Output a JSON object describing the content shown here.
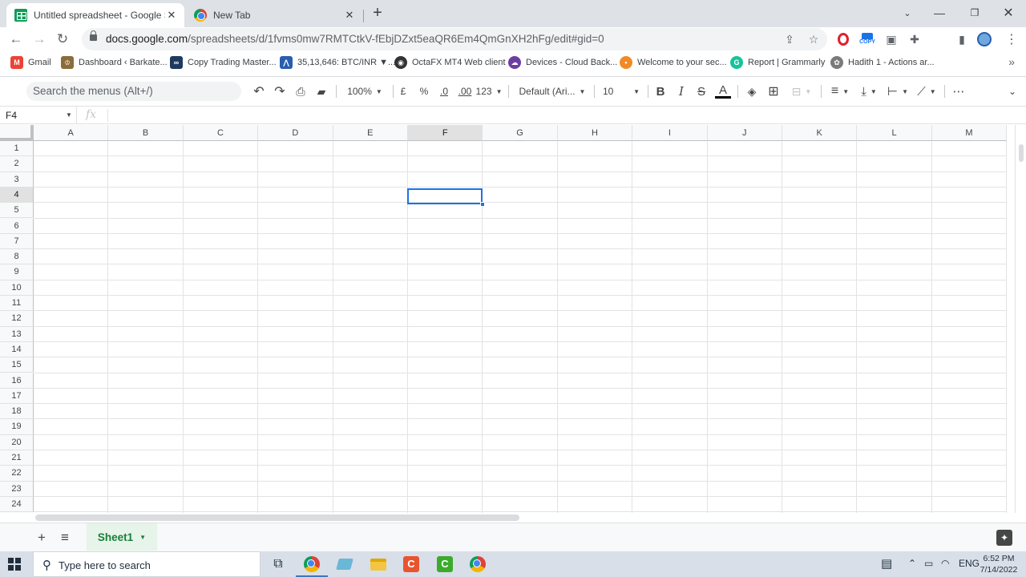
{
  "browser": {
    "tabs": [
      {
        "title": "Untitled spreadsheet - Google Shee",
        "active": true
      },
      {
        "title": "New Tab",
        "active": false
      }
    ],
    "url_host": "docs.google.com",
    "url_path": "/spreadsheets/d/1fvms0mw7RMTCtkV-fEbjDZxt5eaQR6Em4QmGnXH2hFg/edit#gid=0",
    "extension_copy_label": "COPY"
  },
  "bookmarks": [
    {
      "label": "Gmail",
      "icon": "gmail-icon",
      "color": "#ea4335",
      "glyph": "M"
    },
    {
      "label": "Dashboard ‹ Barkate...",
      "icon": "dashboard-icon",
      "color": "#8a6d3b",
      "glyph": "♔"
    },
    {
      "label": "Copy Trading Master...",
      "icon": "copy-trading-icon",
      "color": "#1e3a5f",
      "glyph": "∞"
    },
    {
      "label": "35,13,646: BTC/INR ▼...",
      "icon": "btc-chart-icon",
      "color": "#2a5db0",
      "glyph": "⋀"
    },
    {
      "label": "OctaFX MT4 Web client",
      "icon": "octafx-icon",
      "color": "#333333",
      "glyph": "◉"
    },
    {
      "label": "Devices - Cloud Back...",
      "icon": "cloud-backup-icon",
      "color": "#6a3fa0",
      "glyph": "☁"
    },
    {
      "label": "Welcome to your sec...",
      "icon": "welcome-icon",
      "color": "#f08a24",
      "glyph": "•"
    },
    {
      "label": "Report | Grammarly",
      "icon": "grammarly-icon",
      "color": "#15c39a",
      "glyph": "G"
    },
    {
      "label": "Hadith 1 - Actions ar...",
      "icon": "hadith-icon",
      "color": "#7a7a7a",
      "glyph": "✿"
    }
  ],
  "toolbar": {
    "menu_search_placeholder": "Search the menus (Alt+/)",
    "zoom": "100%",
    "currency": "£",
    "percent": "%",
    "decrease_decimal": ".0",
    "increase_decimal": ".00",
    "more_formats": "123",
    "font": "Default (Ari...",
    "font_size": "10",
    "bold": "B",
    "italic": "I",
    "strikethrough": "S",
    "text_color": "A"
  },
  "formula_bar": {
    "name_box": "F4",
    "fx_label": "fx",
    "value": ""
  },
  "grid": {
    "columns": [
      "A",
      "B",
      "C",
      "D",
      "E",
      "F",
      "G",
      "H",
      "I",
      "J",
      "K",
      "L",
      "M"
    ],
    "rows": [
      "1",
      "2",
      "3",
      "4",
      "5",
      "6",
      "7",
      "8",
      "9",
      "10",
      "11",
      "12",
      "13",
      "14",
      "15",
      "16",
      "17",
      "18",
      "19",
      "20",
      "21",
      "22",
      "23",
      "24"
    ],
    "selected_cell": "F4",
    "selected_column": "F",
    "selected_row": "4"
  },
  "sheets": {
    "tabs": [
      "Sheet1"
    ],
    "active": "Sheet1"
  },
  "taskbar": {
    "search_placeholder": "Type here to search",
    "language": "ENG",
    "time": "6:52 PM",
    "date": "7/14/2022"
  },
  "colors": {
    "accent_blue": "#1a73e8",
    "sheets_green": "#188038",
    "header_bg": "#f8f9fa"
  }
}
